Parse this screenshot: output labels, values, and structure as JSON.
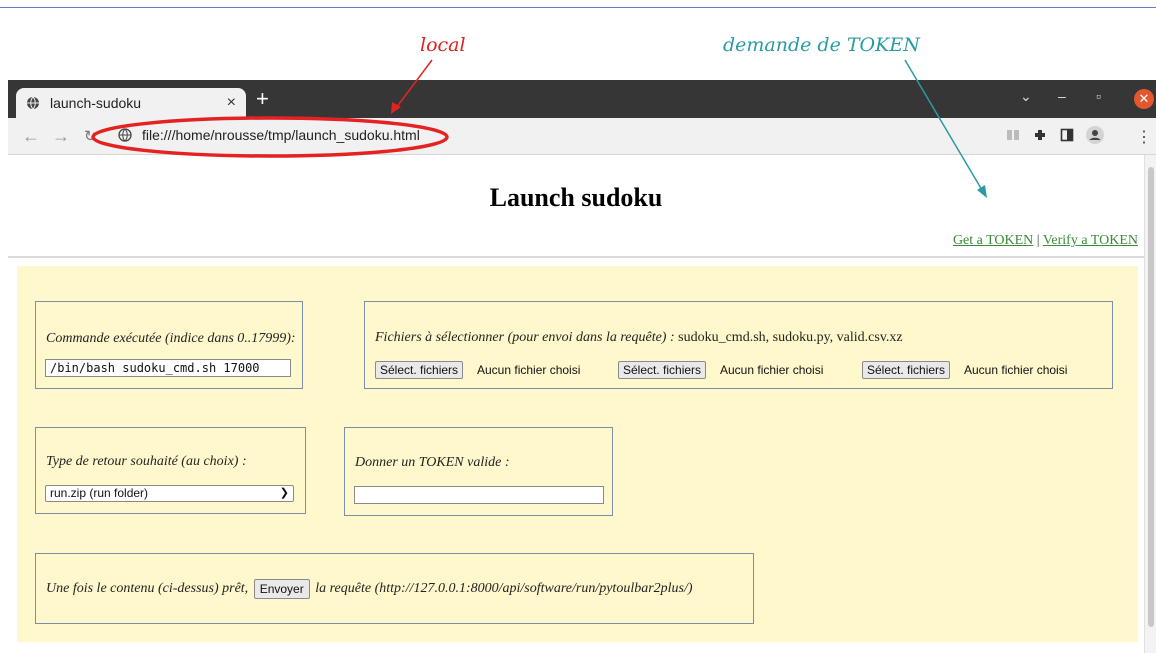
{
  "annotations": {
    "local": "local",
    "token": "demande de TOKEN"
  },
  "colors": {
    "annotation_local": "#e02020",
    "annotation_token": "#2a9ba2",
    "form_background": "#fff8cc",
    "link_green": "#3a8a3a"
  },
  "browser": {
    "tab_title": "launch-sudoku",
    "tab_close": "×",
    "new_tab": "+",
    "url": "file:///home/nrousse/tmp/launch_sudoku.html"
  },
  "page": {
    "title": "Launch sudoku",
    "links": {
      "get_token": "Get a TOKEN",
      "separator": "|",
      "verify_token": "Verify a TOKEN"
    }
  },
  "command": {
    "label": "Commande exécutée (indice dans 0..17999):",
    "value": "/bin/bash sudoku_cmd.sh 17000"
  },
  "files": {
    "label": "Fichiers à sélectionner (pour envoi dans la requête) :",
    "list": "sudoku_cmd.sh, sudoku.py, valid.csv.xz",
    "button_label": "Sélect. fichiers",
    "no_file": "Aucun fichier choisi"
  },
  "return_type": {
    "label": "Type de retour souhaité (au choix) :",
    "selected": "run.zip (run folder)"
  },
  "token": {
    "label": "Donner un TOKEN valide :",
    "value": ""
  },
  "submit": {
    "before": "Une fois le contenu (ci-dessus) prêt,",
    "button": "Envoyer",
    "after": "la requête (http://127.0.0.1:8000/api/software/run/pytoulbar2plus/)"
  }
}
